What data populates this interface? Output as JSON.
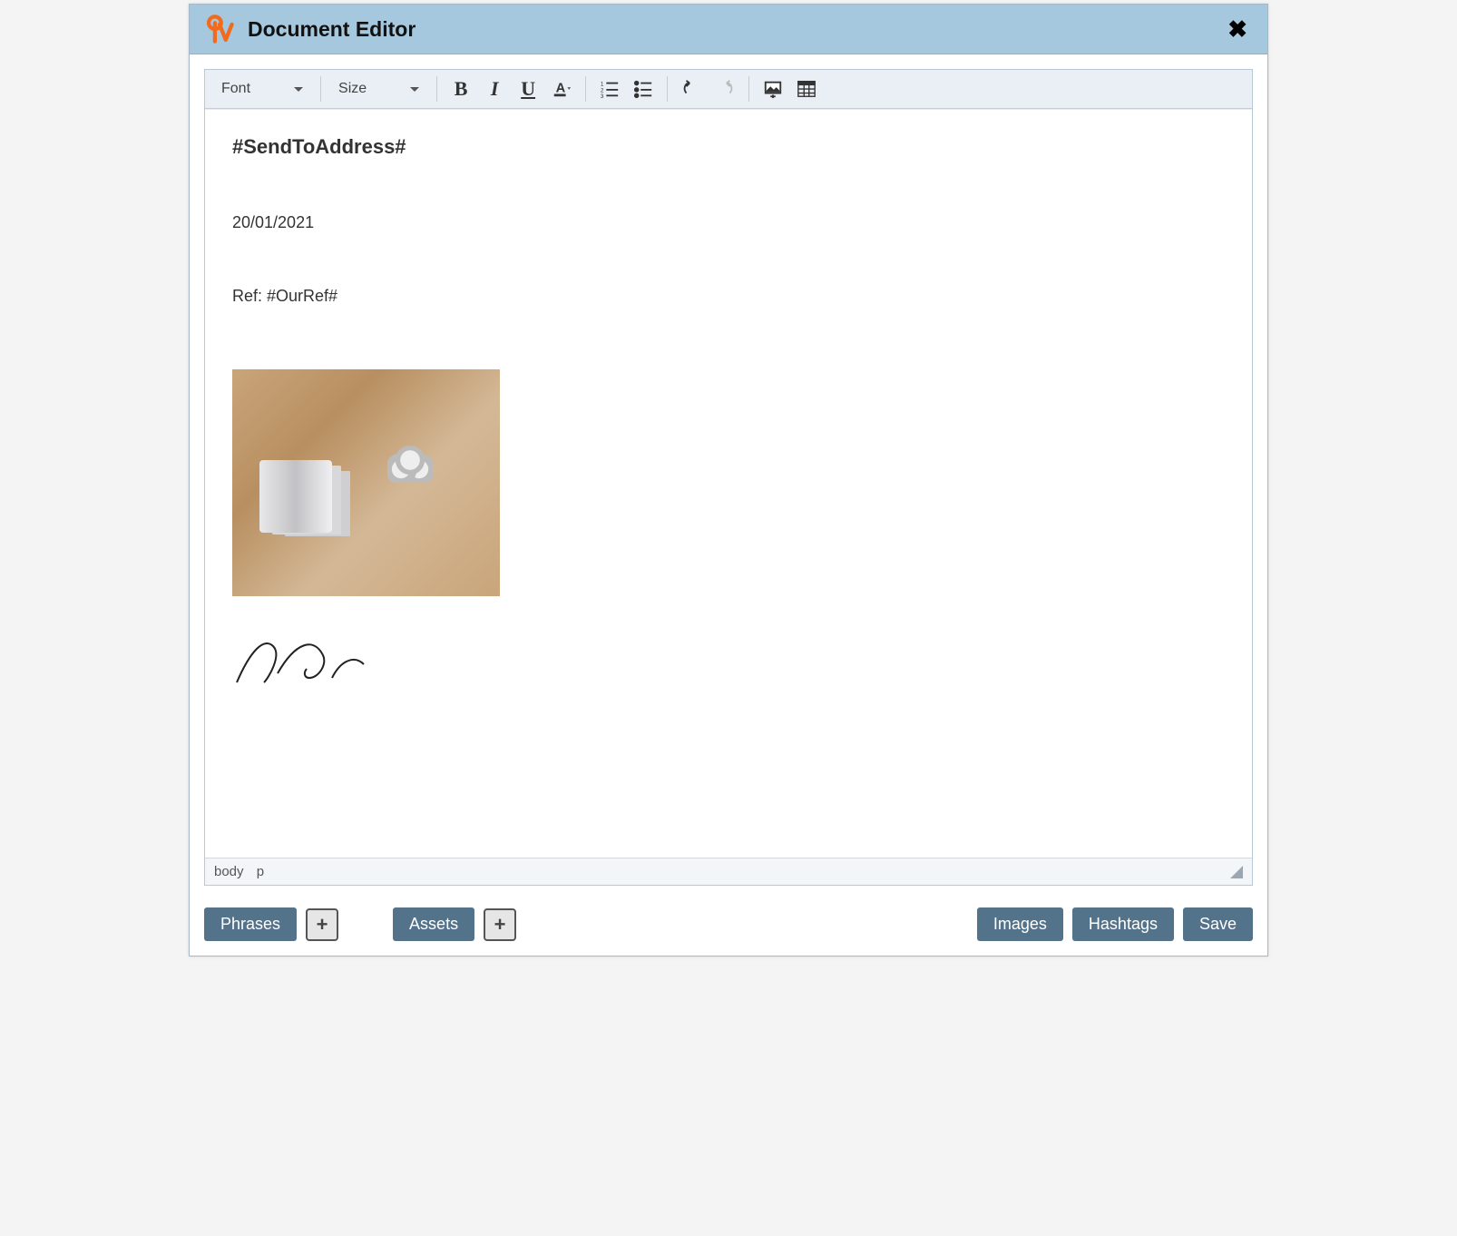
{
  "header": {
    "title": "Document Editor"
  },
  "toolbar": {
    "font_label": "Font",
    "size_label": "Size"
  },
  "document": {
    "heading": "#SendToAddress#",
    "date": "20/01/2021",
    "ref_line": "Ref: #OurRef#"
  },
  "status": {
    "path_body": "body",
    "path_p": "p"
  },
  "footer": {
    "phrases": "Phrases",
    "assets": "Assets",
    "images": "Images",
    "hashtags": "Hashtags",
    "save": "Save",
    "plus": "+"
  }
}
